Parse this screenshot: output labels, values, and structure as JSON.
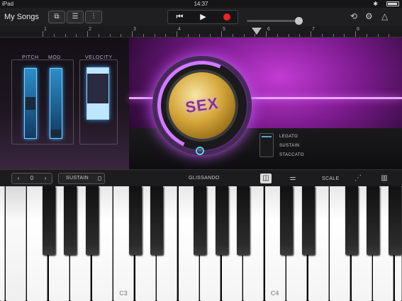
{
  "status": {
    "carrier": "iPad",
    "time": "14:37",
    "battery_level": 0.9
  },
  "toolbar": {
    "my_songs": "My Songs",
    "view_icons": [
      "browser-icon",
      "tracks-icon",
      "mixer-icon"
    ],
    "transport": {
      "rewind": "⏮",
      "play": "▶",
      "record_color": "#e22222"
    },
    "volume_level": 0.88,
    "tool_icons": [
      "loop-icon",
      "settings-icon",
      "metronome-icon"
    ]
  },
  "ruler": {
    "markers": [
      "1",
      "2",
      "3",
      "4",
      "5",
      "6",
      "7",
      "8"
    ]
  },
  "controls": {
    "pitch_label": "PITCH",
    "mod_label": "MOD",
    "velocity_label": "VELOCITY",
    "velocity_level": 0.3
  },
  "instrument": {
    "knob_text": "SEX",
    "articulation": [
      "LEGATO",
      "SUSTAIN",
      "STACCATO"
    ]
  },
  "ctrlbar": {
    "octave_prev": "‹",
    "octave_value": "0",
    "octave_next": "›",
    "sustain": "SUSTAIN",
    "glissando": "GLISSANDO",
    "scale": "SCALE",
    "layout_icons": [
      "keyboard-layout-icon",
      "sliders-icon",
      "arpeggio-icon",
      "keys-icon"
    ]
  },
  "keyboard": {
    "labels": [
      "C3",
      "C4"
    ]
  },
  "colors": {
    "accent": "#c23bd4",
    "glow": "#e070ff",
    "velocity": "#bfe6ff"
  }
}
